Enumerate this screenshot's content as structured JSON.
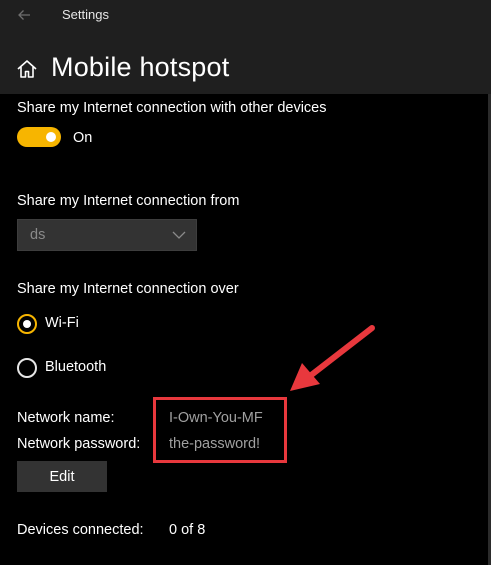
{
  "window": {
    "title": "Settings"
  },
  "header": {
    "title": "Mobile hotspot"
  },
  "share_toggle": {
    "label": "Share my Internet connection with other devices",
    "state_text": "On",
    "on": true
  },
  "share_from": {
    "label": "Share my Internet connection from",
    "selected": "ds"
  },
  "share_over": {
    "label": "Share my Internet connection over",
    "options": [
      {
        "label": "Wi-Fi",
        "selected": true
      },
      {
        "label": "Bluetooth",
        "selected": false
      }
    ]
  },
  "network": {
    "name_label": "Network name:",
    "name_value": "I-Own-You-MF",
    "password_label": "Network password:",
    "password_value": "the-password!",
    "edit_label": "Edit"
  },
  "devices": {
    "label": "Devices connected:",
    "value": "0 of 8"
  },
  "colors": {
    "accent": "#f7b500",
    "annotation": "#e8383d",
    "background": "#000000",
    "header": "#1f1f1f"
  },
  "icons": {
    "back": "back-arrow-icon",
    "home": "home-icon",
    "dropdown": "chevron-down-icon"
  }
}
